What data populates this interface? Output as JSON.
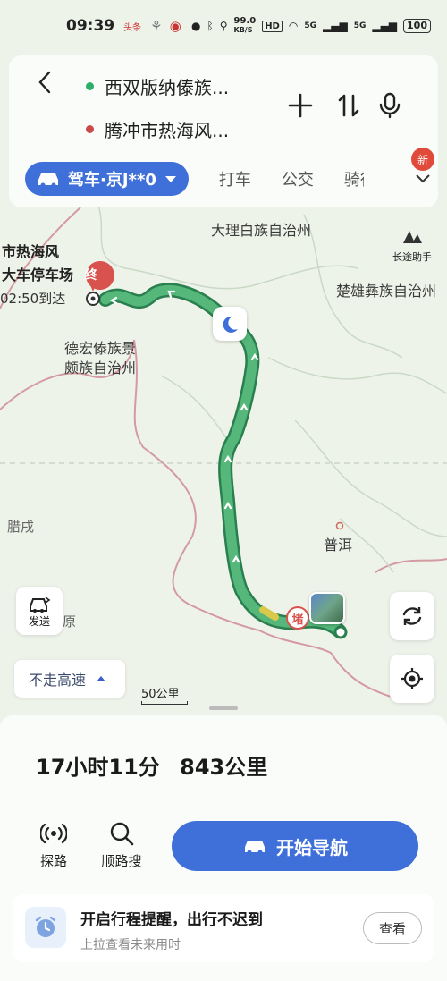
{
  "status_bar": {
    "time": "09:39",
    "carrier_tag": "头条",
    "net_speed_value": "99.0",
    "net_speed_unit": "KB/S",
    "hd_label": "HD",
    "sim1_label": "5G",
    "sim2_label": "5G",
    "battery": "100"
  },
  "route": {
    "origin": "西双版纳傣族...",
    "destination": "腾冲市热海风...",
    "origin_color": "#2fae6a",
    "destination_color": "#c84a4a"
  },
  "modes": {
    "active": "驾车·京J**0",
    "tabs": [
      "打车",
      "公交",
      "骑行"
    ],
    "new_badge": "新"
  },
  "map": {
    "dest_label_line1": "市热海风",
    "dest_label_line2": "大车停车场",
    "dest_eta": "02:50到达",
    "dest_marker": "终",
    "regions": [
      "大理白族自治州",
      "楚雄彝族自治州",
      "德宏傣族景",
      "颇族自治州",
      "腊戌",
      "普洱",
      "原"
    ],
    "long_trip_label": "长途助手",
    "send_label": "发送",
    "toll_marker": "堵",
    "avoid_highway": "不走高速",
    "scale_label": "50公里",
    "route_color": "#3aa766",
    "route_outline": "#2a7f4e"
  },
  "summary": {
    "duration": "17小时11分",
    "distance": "843公里"
  },
  "actions": {
    "explore": "探路",
    "along_search": "顺路搜",
    "start_nav": "开始导航"
  },
  "reminder": {
    "title": "开启行程提醒，出行不迟到",
    "subtitle": "上拉查看未来用时",
    "button": "查看"
  },
  "colors": {
    "primary": "#3f6fd8"
  }
}
